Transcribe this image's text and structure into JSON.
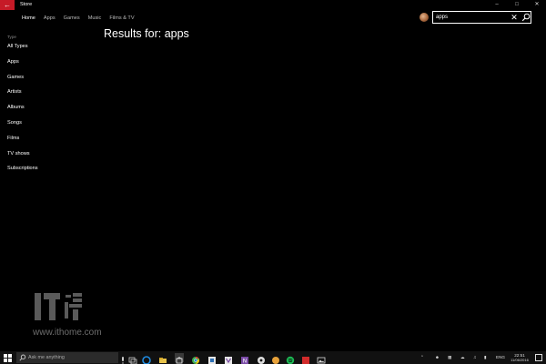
{
  "window": {
    "title": "Store",
    "back_icon": "back-arrow-icon",
    "controls": [
      "minimize-icon",
      "maximize-icon",
      "close-icon"
    ],
    "accent_color": "#c61a27"
  },
  "nav": {
    "items": [
      "Home",
      "Apps",
      "Games",
      "Music",
      "Films & TV"
    ],
    "active_index": 0
  },
  "search": {
    "value": "apps",
    "clear_icon": "clear-icon",
    "submit_icon": "search-icon"
  },
  "sidebar": {
    "heading": "Type",
    "items": [
      "All Types",
      "Apps",
      "Games",
      "Artists",
      "Albums",
      "Songs",
      "Films",
      "TV shows",
      "Subscriptions"
    ]
  },
  "results": {
    "prefix": "Results for:",
    "query": "apps"
  },
  "watermark": {
    "url": "www.ithome.com",
    "logo": "ithome-logo",
    "logo_text": "IT 之家"
  },
  "taskbar": {
    "search_placeholder": "Ask me anything",
    "pinned_icons": [
      "task-view-icon",
      "edge-icon",
      "file-explorer-icon",
      "store-icon",
      "chrome-icon",
      "app-icon",
      "visual-studio-icon",
      "onenote-icon",
      "spotify-icon",
      "app-icon",
      "app-icon",
      "spotify-icon",
      "app-icon",
      "photos-icon"
    ],
    "tray_language": "ENG",
    "clock_time": "22:51",
    "clock_date": "11/06/2016"
  }
}
